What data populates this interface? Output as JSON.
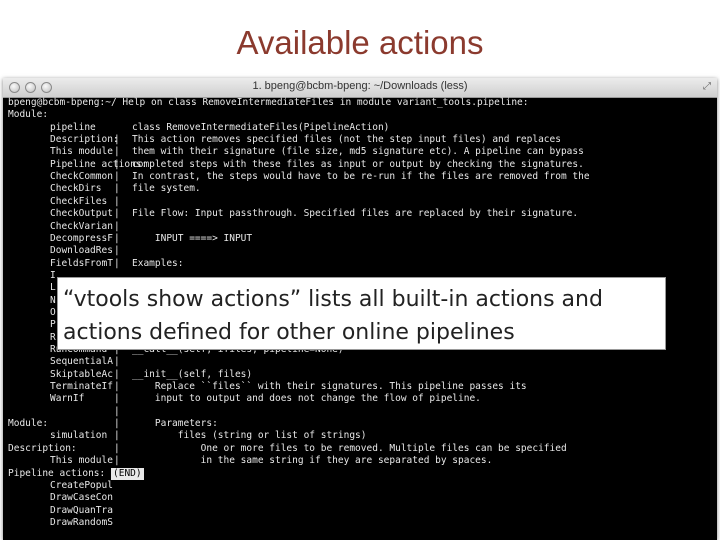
{
  "slide": {
    "title": "Available actions",
    "title_color": "#8b3a2e"
  },
  "window": {
    "title": "1. bpeng@bcbm-bpeng: ~/Downloads (less)",
    "tab_label": "bpeng@bcbm-bpeng: ~/Downloads (less)",
    "close_icon": "traffic-light-close",
    "minimize_icon": "traffic-light-minimize",
    "zoom_icon": "traffic-light-zoom",
    "resize_icon": "fullscreen-arrows"
  },
  "terminal": {
    "bg_color": "#000000",
    "fg_color": "#e8e8e8",
    "lines": [
      {
        "c1": "",
        "c2": "",
        "c3": "",
        "full": "bpeng@bcbm-bpeng:~/ Help on class RemoveIntermediateFiles in module variant_tools.pipeline:"
      },
      {
        "full": "Module:"
      },
      {
        "c1": "pipeline",
        "c2": "",
        "c3": "class RemoveIntermediateFiles(PipelineAction)"
      },
      {
        "c1": "Description:",
        "c2": "|",
        "c3": "This action removes specified files (not the step input files) and replaces"
      },
      {
        "c1": "This module",
        "c2": "|",
        "c3": "them with their signature (file size, md5 signature etc). A pipeline can bypass"
      },
      {
        "c1": "Pipeline actions:",
        "c2": "|",
        "c3": "completed steps with these files as input or output by checking the signatures."
      },
      {
        "c1": "CheckCommon",
        "c2": "|",
        "c3": "In contrast, the steps would have to be re-run if the files are removed from the"
      },
      {
        "c1": "CheckDirs",
        "c2": "|",
        "c3": "file system."
      },
      {
        "c1": "CheckFiles",
        "c2": "|",
        "c3": ""
      },
      {
        "c1": "CheckOutput",
        "c2": "|",
        "c3": "File Flow: Input passthrough. Specified files are replaced by their signature."
      },
      {
        "c1": "CheckVarian",
        "c2": "|",
        "c3": ""
      },
      {
        "c1": "DecompressF",
        "c2": "|",
        "c3": "    INPUT ====> INPUT"
      },
      {
        "c1": "DownloadRes",
        "c2": "|",
        "c3": ""
      },
      {
        "c1": "FieldsFromT",
        "c2": "|",
        "c3": "Examples:"
      },
      {
        "c1": "I",
        "c2": "",
        "c3": ""
      },
      {
        "c1": "L",
        "c2": "",
        "c3": ""
      },
      {
        "c1": "N",
        "c2": "",
        "c3": ""
      },
      {
        "c1": "O",
        "c2": "",
        "c3": ""
      },
      {
        "c1": "P",
        "c2": "",
        "c3": ""
      },
      {
        "c1": "R",
        "c2": "",
        "c3": ""
      },
      {
        "c1": "RunCommand",
        "c2": "|",
        "c3": "__call__(self, ifiles, pipeline=None)"
      },
      {
        "c1": "SequentialA",
        "c2": "|",
        "c3": ""
      },
      {
        "c1": "SkiptableAc",
        "c2": "|",
        "c3": "__init__(self, files)"
      },
      {
        "c1": "TerminateIf",
        "c2": "|",
        "c3": "    Replace ``files`` with their signatures. This pipeline passes its"
      },
      {
        "c1": "WarnIf",
        "c2": "|",
        "c3": "    input to output and does not change the flow of pipeline."
      },
      {
        "c1": "",
        "c2": "|",
        "c3": ""
      },
      {
        "full": "Module:",
        "c2": "|",
        "c3": "    Parameters:"
      },
      {
        "c1": "simulation",
        "c2": "|",
        "c3": "        files (string or list of strings)"
      },
      {
        "full": "Description:",
        "c2": "|",
        "c3": "            One or more files to be removed. Multiple files can be specified"
      },
      {
        "c1": "This module",
        "c2": "|",
        "c3": "            in the same string if they are separated by spaces."
      },
      {
        "full": "Pipeline actions:",
        "end": "(END)"
      },
      {
        "c1": "CreatePopul"
      },
      {
        "c1": "DrawCaseCon"
      },
      {
        "c1": "DrawQuanTra"
      },
      {
        "c1": "DrawRandomS"
      }
    ]
  },
  "overlay": {
    "text": "“vtools show actions” lists all built-in actions and actions defined for other online pipelines"
  }
}
